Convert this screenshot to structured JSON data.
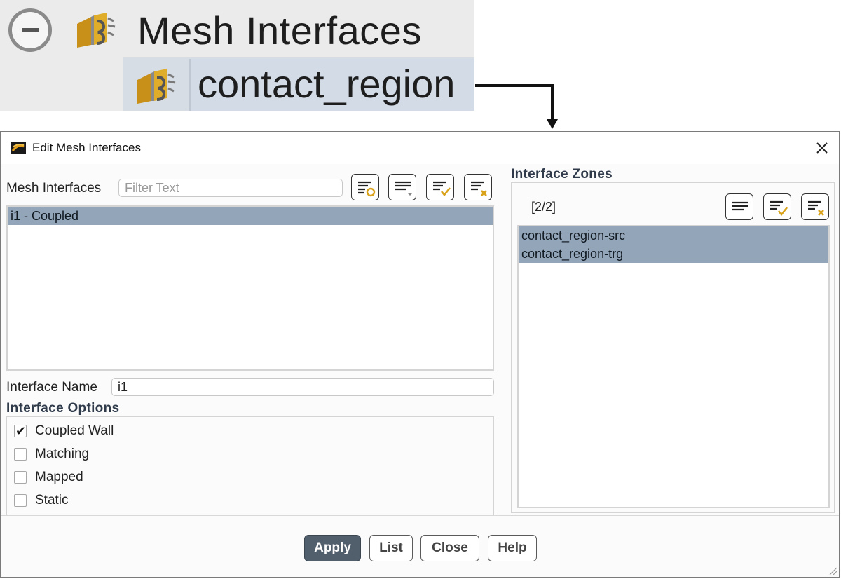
{
  "tree": {
    "parent_label": "Mesh Interfaces",
    "child_label": "contact_region",
    "parent_icon": "mesh-interface-icon",
    "child_icon": "mesh-interface-icon"
  },
  "dialog": {
    "title": "Edit Mesh Interfaces",
    "app_icon": "fluent-app-icon",
    "close_icon": "close-icon",
    "mesh_interfaces": {
      "label": "Mesh Interfaces",
      "filter_placeholder": "Filter Text",
      "filter_value": "",
      "toolbar_icons": [
        "filter-create-icon",
        "filter-dropdown-icon",
        "select-all-icon",
        "deselect-all-icon"
      ],
      "items": [
        {
          "label": "i1 - Coupled",
          "selected": true
        }
      ]
    },
    "interface_name": {
      "label": "Interface Name",
      "value": "i1"
    },
    "interface_options": {
      "title": "Interface Options",
      "options": [
        {
          "label": "Coupled Wall",
          "checked": true
        },
        {
          "label": "Matching",
          "checked": false
        },
        {
          "label": "Mapped",
          "checked": false
        },
        {
          "label": "Static",
          "checked": false
        }
      ]
    },
    "interface_zones": {
      "title": "Interface Zones",
      "count": "[2/2]",
      "toolbar_icons": [
        "filter-list-icon",
        "select-all-icon",
        "deselect-all-icon"
      ],
      "items": [
        {
          "label": "contact_region-src",
          "selected": true
        },
        {
          "label": "contact_region-trg",
          "selected": true
        }
      ]
    },
    "buttons": {
      "apply": "Apply",
      "list": "List",
      "close": "Close",
      "help": "Help"
    }
  },
  "colors": {
    "selection": "#93a5b8",
    "primary_button": "#515e6c",
    "section_title": "#2f3a4a",
    "icon_accent": "#d9a21b"
  }
}
